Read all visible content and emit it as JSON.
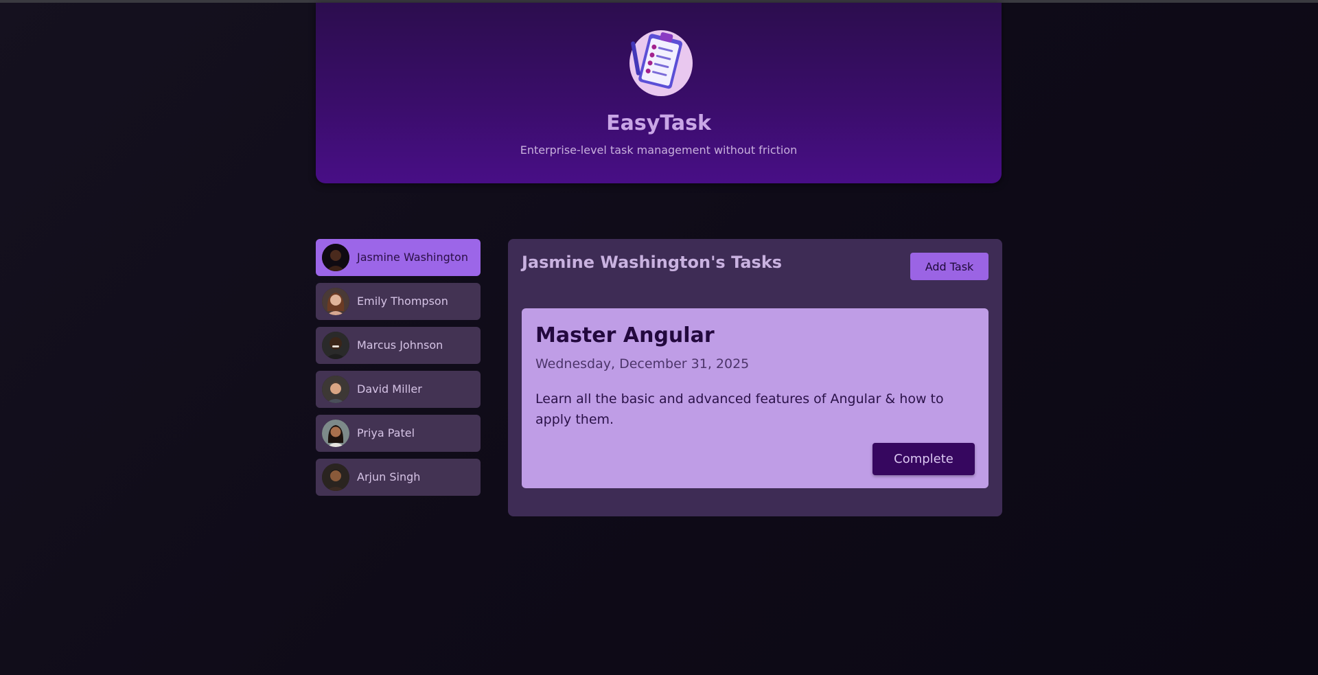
{
  "header": {
    "title": "EasyTask",
    "subtitle": "Enterprise-level task management without friction",
    "logo_icon": "clipboard-checklist-icon"
  },
  "users": [
    {
      "name": "Jasmine Washington",
      "selected": true,
      "avatar_icon": "user-avatar-icon"
    },
    {
      "name": "Emily Thompson",
      "selected": false,
      "avatar_icon": "user-avatar-icon"
    },
    {
      "name": "Marcus Johnson",
      "selected": false,
      "avatar_icon": "user-avatar-icon"
    },
    {
      "name": "David Miller",
      "selected": false,
      "avatar_icon": "user-avatar-icon"
    },
    {
      "name": "Priya Patel",
      "selected": false,
      "avatar_icon": "user-avatar-icon"
    },
    {
      "name": "Arjun Singh",
      "selected": false,
      "avatar_icon": "user-avatar-icon"
    }
  ],
  "tasks_panel": {
    "title": "Jasmine Washington's Tasks",
    "add_task_label": "Add Task",
    "tasks": [
      {
        "title": "Master Angular",
        "date": "Wednesday, December 31, 2025",
        "description": "Learn all the basic and advanced features of Angular & how to apply them.",
        "complete_label": "Complete"
      }
    ]
  },
  "colors": {
    "header_top": "#2c0d4e",
    "header_bottom": "#480e86",
    "selected_user": "#9c66e8",
    "user_item": "#433353",
    "panel": "#3e2c55",
    "task_card": "#bf9de6",
    "complete_button": "#36075f",
    "add_task_button": "#9b64e4"
  }
}
